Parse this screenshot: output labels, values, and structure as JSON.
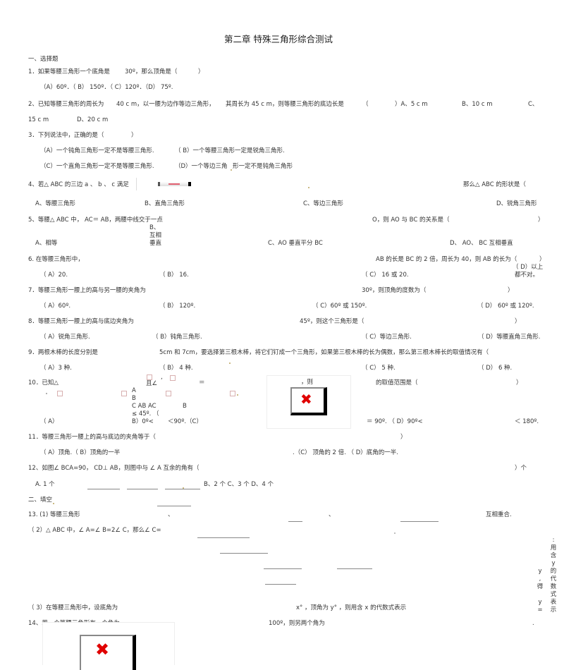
{
  "title": "第二章 特殊三角形综合测试",
  "section1": "一、选择题",
  "q1": {
    "stem": "1．如果等腰三角形一个底角是",
    "value": "30º，那么顶角是（",
    "close": "）",
    "options": "（A）60º．（ B） 150º．（ C）120º．（D） 75º."
  },
  "q2": {
    "stem": "2、已知等腰三角形的周长为",
    "perimeter": "40 c m，以一腰为边作等边三角形，",
    "stem2": "其周长为  45 c m，则等腰三角形的底边长是",
    "paren": "（",
    "optA": "）A、5 c m",
    "optB": "B、10 c m",
    "optC": "C、",
    "optC2": "15 c m",
    "optD": "D、20 c m"
  },
  "q3": {
    "stem": "3．下列说法中，正确的是（",
    "close": "）",
    "optA": "（A）一个钝角三角形一定不是等腰三角形.",
    "optB": "（ B）一个等腰三角形一定是锐角三角形.",
    "optC": "（C）一个直角三角形一定不是等腰三角形.",
    "optD1": "（D）一个等边三角",
    "optD2": "形一定不是钝角三角形"
  },
  "q4": {
    "stem": "4、若△ ABC 的三边 a 、 b 、 c 满足",
    "stem2": "那么△ ABC 的形状是（",
    "optA": "A、等腰三角形",
    "optB": "B、直角三角形",
    "optC": "C、等边三角形",
    "optD": "D、锐角三角形"
  },
  "q5": {
    "stem": "5、等腰△ ABC 中， AC＝ AB，两腰中线交于一点",
    "stem2": "O，则 AO 与 BC 的关系是（",
    "close": "）",
    "optA": "A、相等",
    "optB": [
      "B、",
      "互相",
      "垂直"
    ],
    "optC": "C、AO 垂直平分  BC",
    "optD": "D、 AO、 BC 互相垂直"
  },
  "q6": {
    "stem": "6. 在等腰三角形中，",
    "stem2": "AB 的长是  BC 的 2 倍，周长为  40，则 AB 的长为（",
    "close": "）",
    "optA": "（ A）20.",
    "optB": "（ B） 16.",
    "optC": "（ C） 16 或 20.",
    "optD": [
      "（ D）以上",
      "都不对。"
    ]
  },
  "q7": {
    "stem": "7．等腰三角形一腰上的高与另一腰的夹角为",
    "stem2": "30º，则顶角的度数为（",
    "close": "）",
    "optA": "（ A）60º.",
    "optB": "（ B） 120º.",
    "optC": "（ C）60º 或 150º.",
    "optD": "（ D） 60º 或 120º."
  },
  "q8": {
    "stem": "8．等腰三角形一腰上的高与底边夹角为",
    "stem2": "45º，则这个三角形是（",
    "close": "）",
    "optA": "（ A）锐角三角形.",
    "optB": "（ B）钝角三角形.",
    "optC": "（ C）等边三角形.",
    "optD": "（ D）等腰直角三角形."
  },
  "q9": {
    "stem": "9．两根木棒的长度分别是",
    "stem2": "5cm 和 7cm，要选择第三根木棒，将它们钉成一个三角形，如果第三根木棒的长为偶数，那么第三根木棒长的取值情况有（",
    "optA": "（ A）3 种.",
    "optB": "（ B） 4 种.",
    "optC": "（ C） 5 种.",
    "optD": "（ D） 6 种."
  },
  "q10": {
    "stem": "10．已知△",
    "and_angle": "且∠",
    "equals": "＝",
    "then": "，则",
    "range": "的取值范围是（",
    "close": "）",
    "col": [
      "A",
      "B",
      "C AB  AC",
      "≤ 45º.   （",
      "B）0º<"
    ],
    "colB": "B",
    "optA": "（ A）",
    "lt90": "＜90º.（C）",
    "eq90": "＝ 90º.  （ D）90º<",
    "lt180": "＜ 180º."
  },
  "q11": {
    "stem": "11．等腰三角形一腰上的高与底边的夹角等于（",
    "close": "）",
    "optAB": "（ A）顶角.（ B）顶角的一半",
    "optCD": ".（C） 顶角的 2 倍.   （ D）底角的一半."
  },
  "q12": {
    "stem": "12、如图∠ BCA=90， CD⊥ AB，则图中与 ∠ A 互余的角有（",
    "close": "）个",
    "optA": "A.  1 个",
    "optBCD": "B、2 个  C、3 个  D、4 个"
  },
  "section2": "二、填空",
  "q13": {
    "p1": "13.  (1) 等腰三角形",
    "p1_sep": "、",
    "p1_end": "互相重合.",
    "p2": "（ 2）△ ABC 中，∠ A=∠ B=2∠ C，那么∠ C=",
    "p3": "（ 3）在等腰三角形中，设底角为",
    "p3b": "x° ，顶角为  y° ，则用含  x 的代数式表示",
    "vert1": [
      ":",
      "用",
      "含",
      "y",
      "的",
      "代",
      "数",
      "式",
      "表",
      "示"
    ],
    "vert2": [
      "y",
      ",",
      "得",
      "",
      "y",
      "="
    ]
  },
  "q14": {
    "stem": "14、若一个等腰三角形有一个角为",
    "stem2": "100º，则另两个角为",
    "end": "."
  },
  "icons": {
    "broken_image": "broken-image-icon",
    "formula_strip": "formula-image-icon"
  }
}
